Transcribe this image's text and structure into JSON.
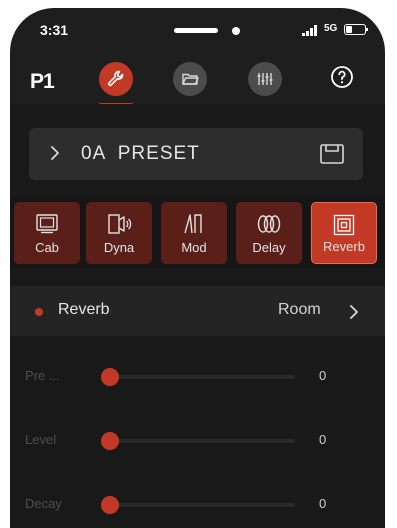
{
  "status": {
    "time": "3:31",
    "network": "5G"
  },
  "nav": {
    "logo": "P1",
    "icons": [
      "wrench-icon",
      "folder-icon",
      "mixer-icon",
      "help-icon"
    ],
    "active_index": 0
  },
  "preset": {
    "name": "0A  PRESET"
  },
  "effects": [
    {
      "label": "Cab",
      "icon": "cab-icon",
      "active": false
    },
    {
      "label": "Dyna",
      "icon": "dyna-icon",
      "active": false
    },
    {
      "label": "Mod",
      "icon": "mod-icon",
      "active": false
    },
    {
      "label": "Delay",
      "icon": "delay-icon",
      "active": false
    },
    {
      "label": "Reverb",
      "icon": "reverb-icon",
      "active": true
    }
  ],
  "module": {
    "title": "Reverb",
    "type": "Room"
  },
  "params": [
    {
      "label": "Pre ...",
      "value": "0",
      "level": 0
    },
    {
      "label": "Level",
      "value": "0",
      "level": 0
    },
    {
      "label": "Decay",
      "value": "0",
      "level": 0
    }
  ],
  "colors": {
    "accent": "#c23a26",
    "effect_inactive": "#5a1f18",
    "background": "#191919"
  }
}
